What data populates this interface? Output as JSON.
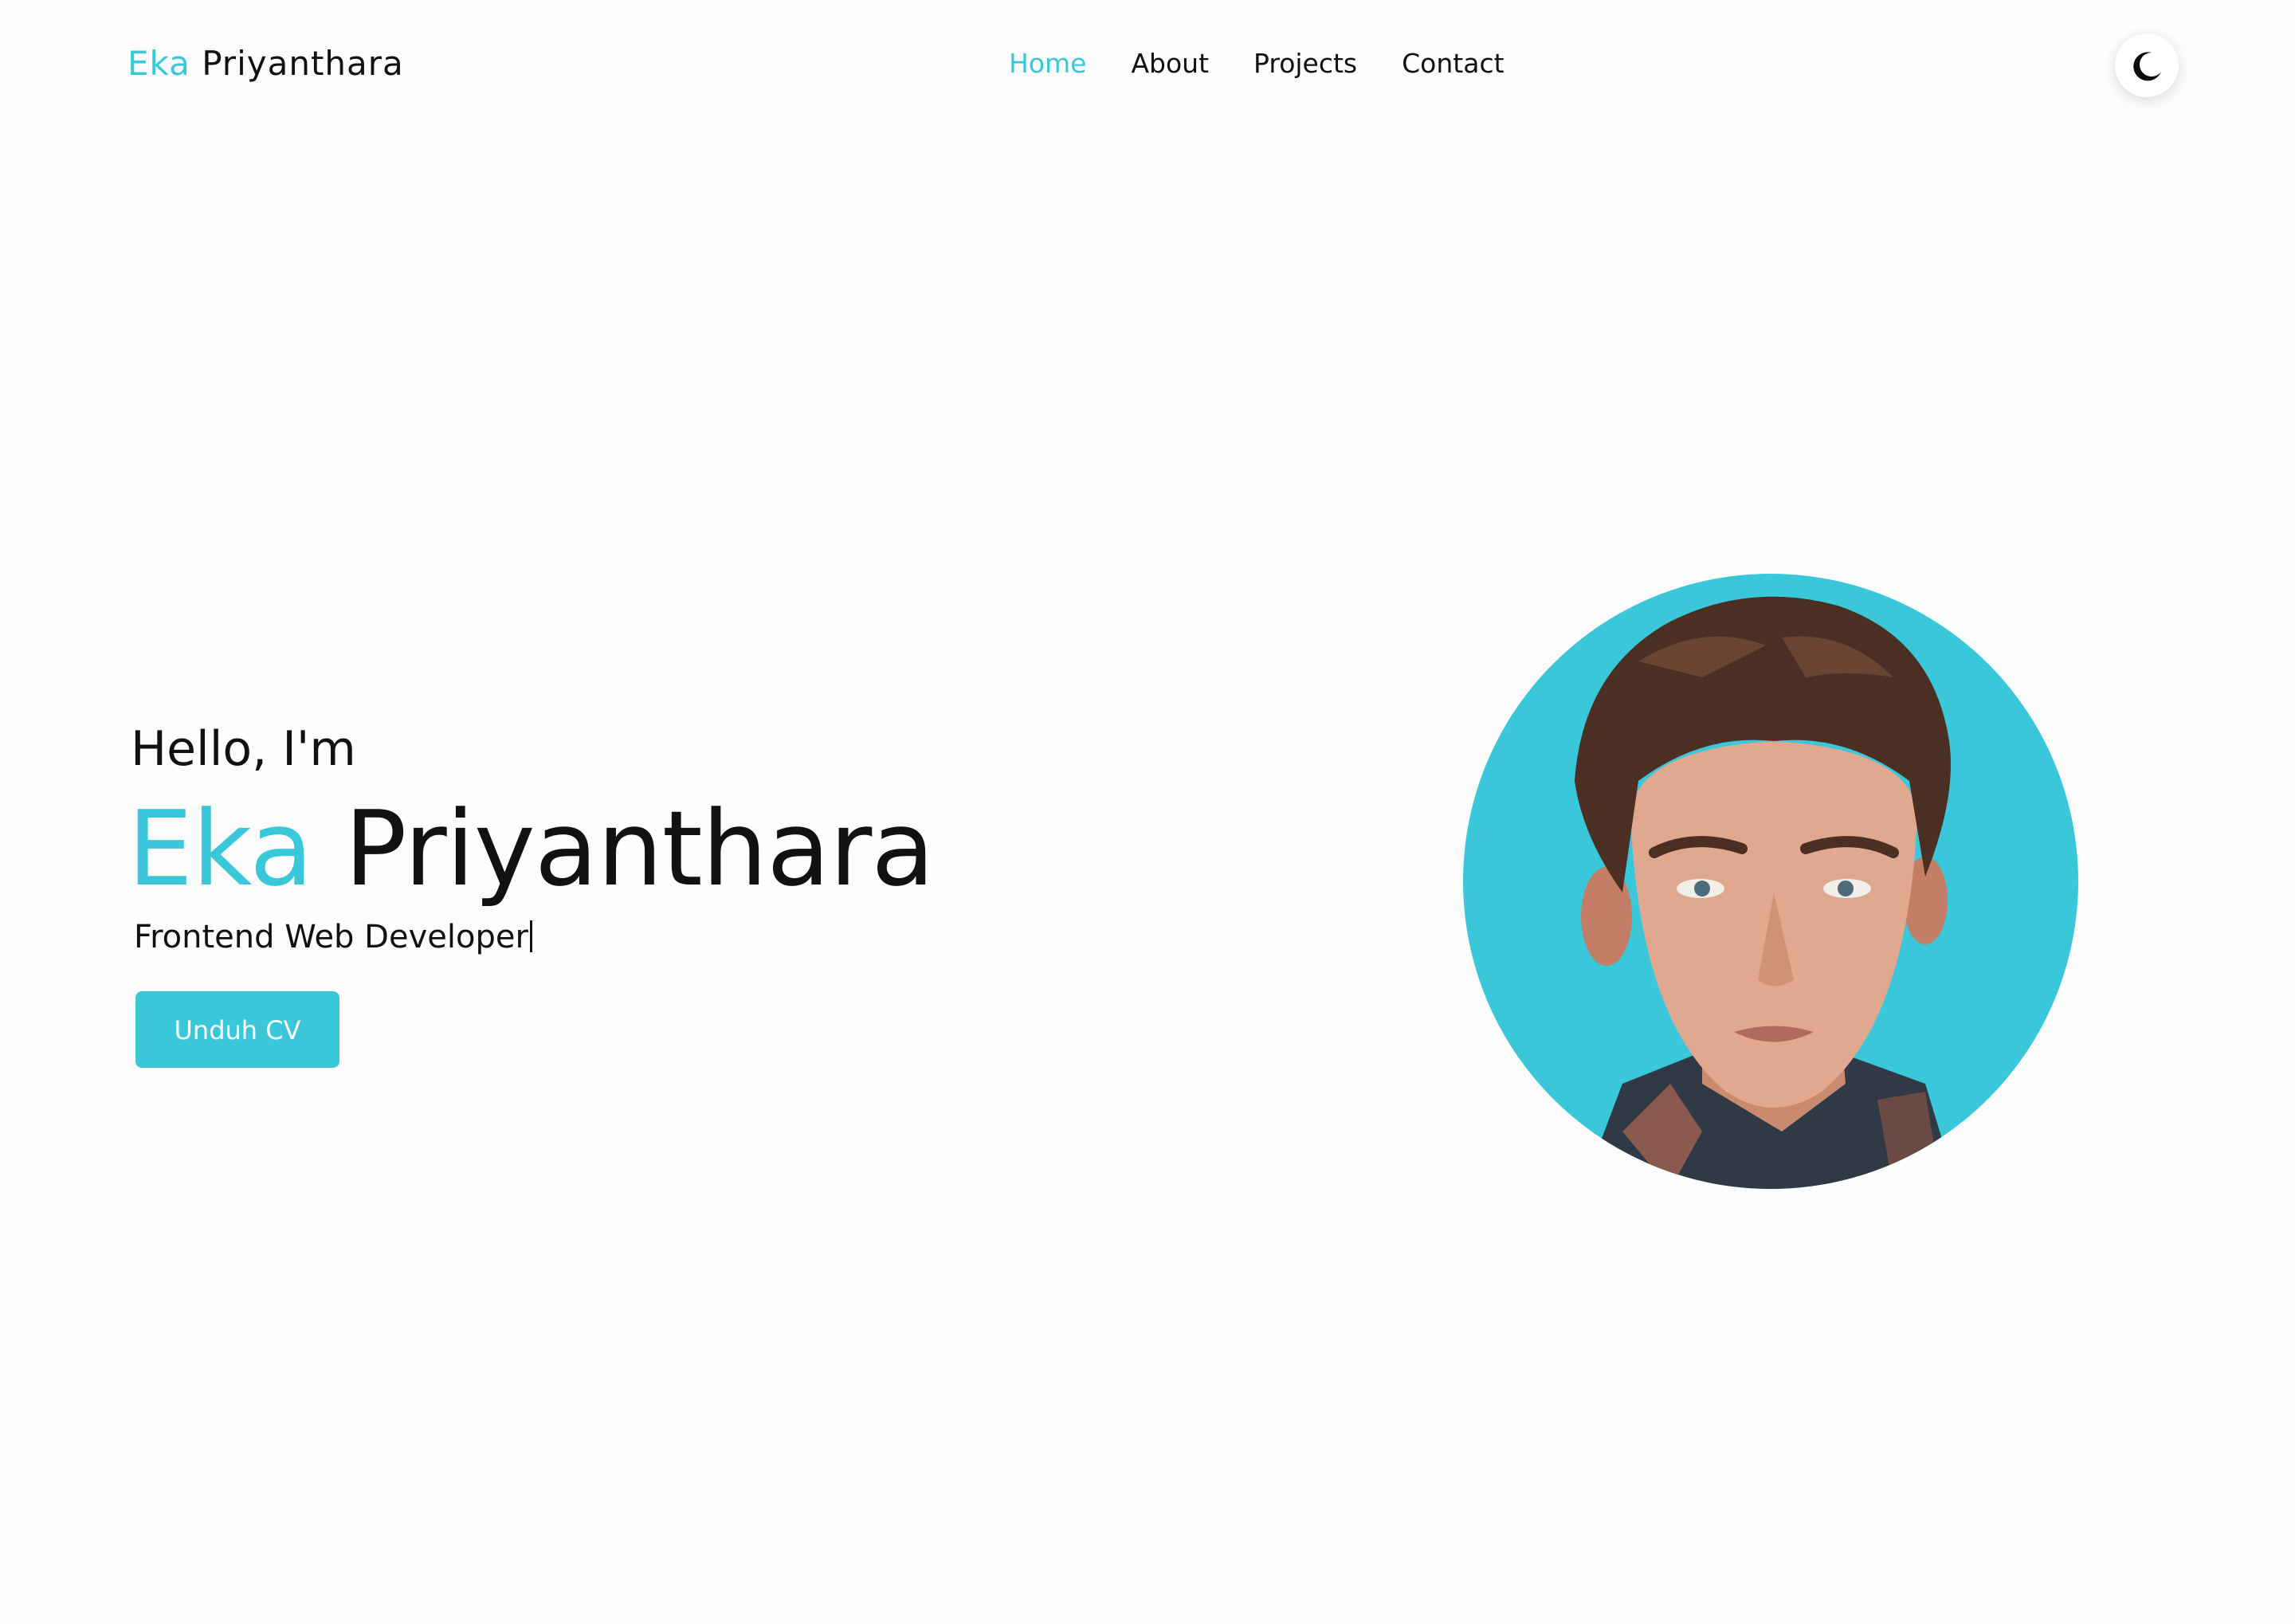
{
  "brand": {
    "first": "Eka",
    "last": "Priyanthara"
  },
  "nav": {
    "items": [
      {
        "label": "Home",
        "active": true
      },
      {
        "label": "About",
        "active": false
      },
      {
        "label": "Projects",
        "active": false
      },
      {
        "label": "Contact",
        "active": false
      }
    ]
  },
  "theme_toggle": {
    "icon": "moon-icon"
  },
  "hero": {
    "greeting": "Hello, I'm",
    "first_name": "Eka",
    "last_name": "Priyanthara",
    "role": "Frontend Web Developer",
    "cta_label": "Unduh CV"
  },
  "profile_photo": {
    "icon": "avatar-photo"
  },
  "colors": {
    "accent": "#3ac7da",
    "text": "#111111",
    "background": "#fefdfd"
  }
}
